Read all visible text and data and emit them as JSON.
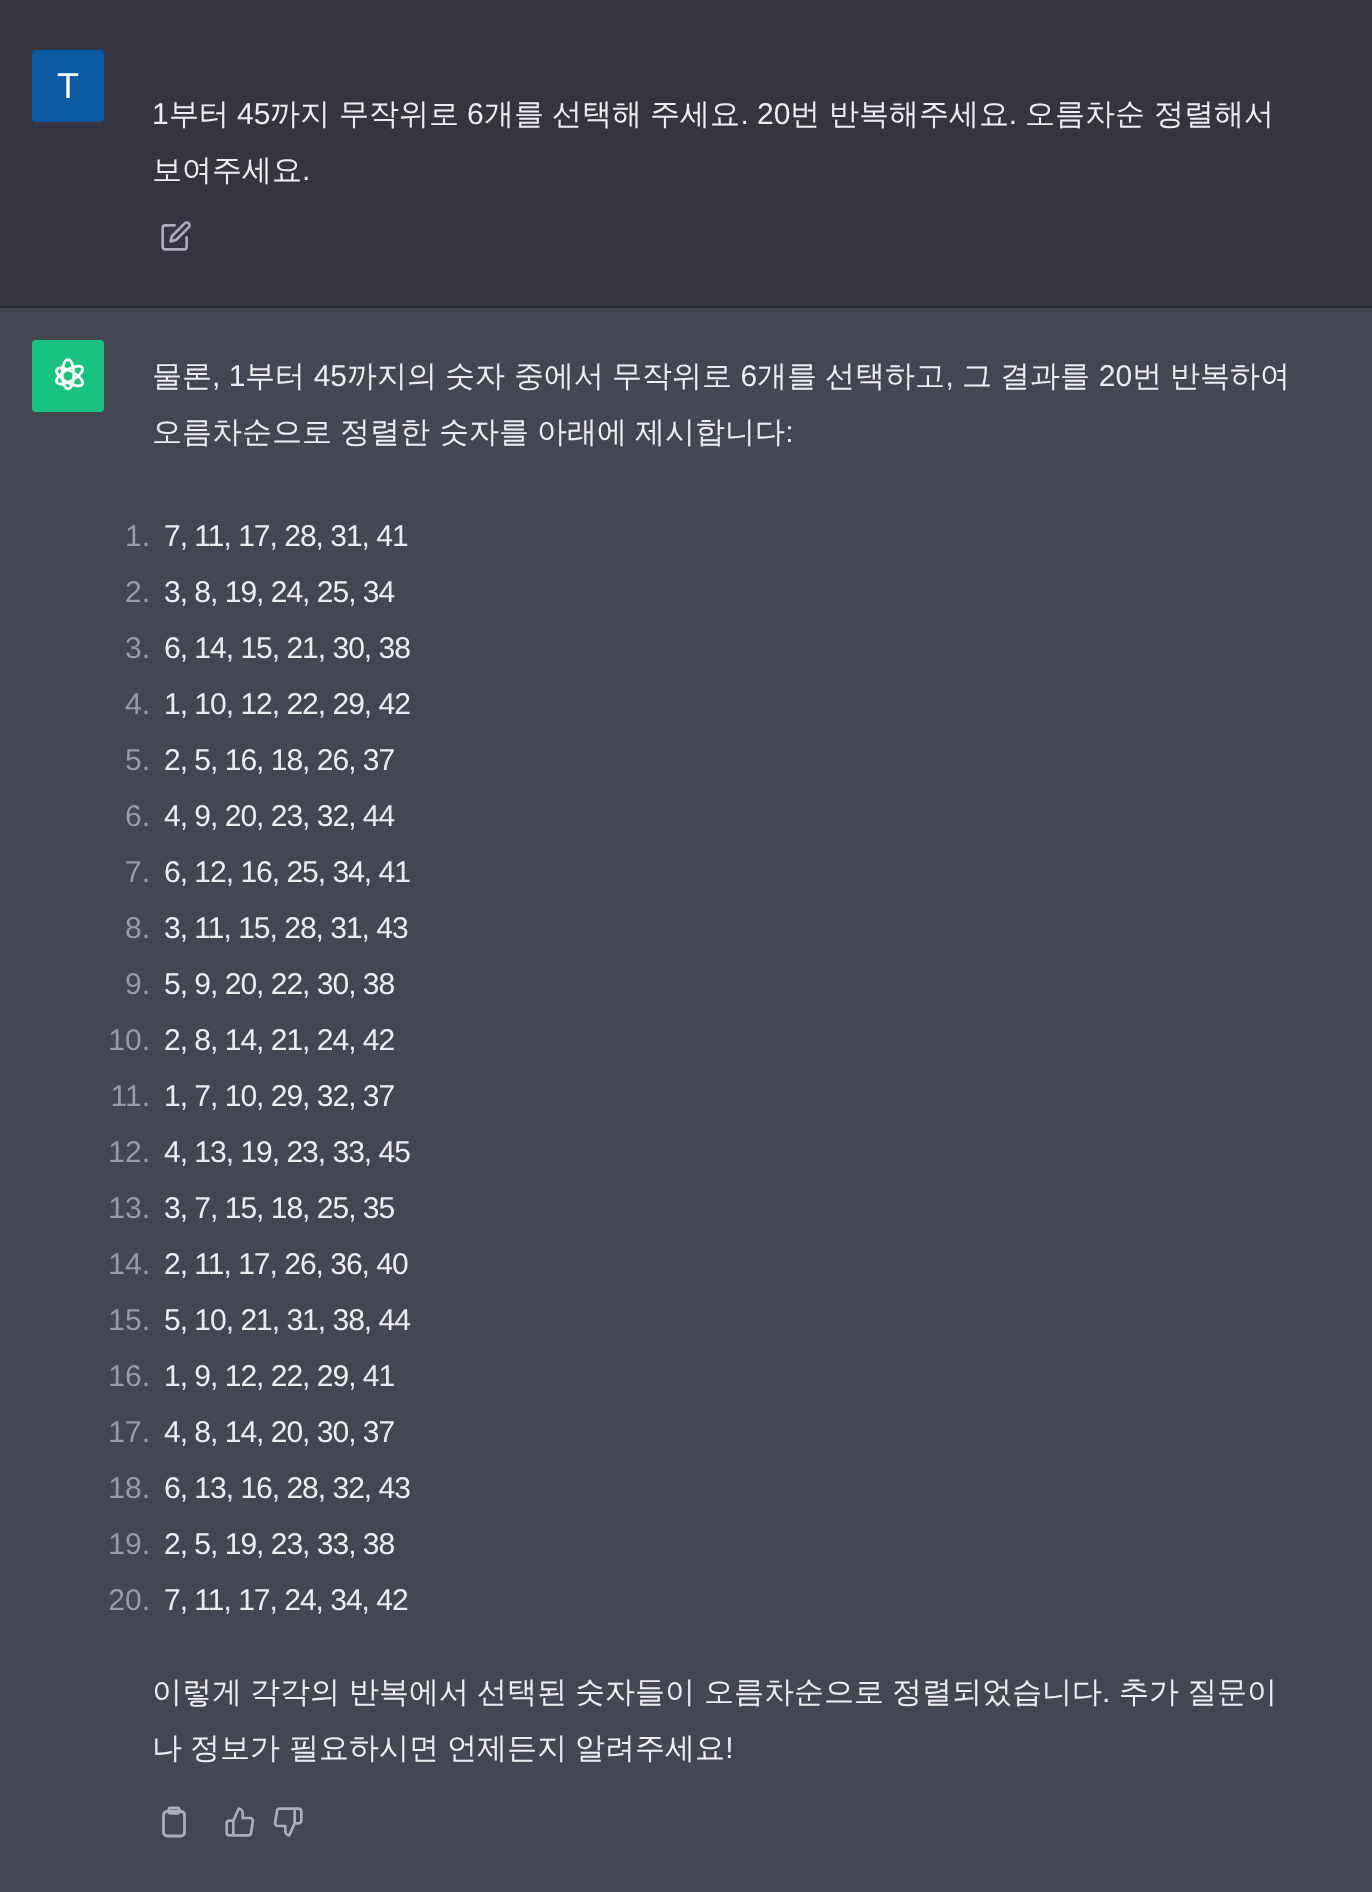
{
  "user_message": {
    "avatar": "T",
    "text": "1부터 45까지 무작위로 6개를 선택해 주세요. 20번 반복해주세요. 오름차순 정렬해서 보여주세요."
  },
  "assistant_message": {
    "intro": "물론, 1부터 45까지의 숫자 중에서 무작위로 6개를 선택하고, 그 결과를 20번 반복하여 오름차순으로 정렬한 숫자를 아래에 제시합니다:",
    "list": [
      {
        "marker": "1.",
        "text": "7, 11, 17, 28, 31, 41"
      },
      {
        "marker": "2.",
        "text": "3, 8, 19, 24, 25, 34"
      },
      {
        "marker": "3.",
        "text": "6, 14, 15, 21, 30, 38"
      },
      {
        "marker": "4.",
        "text": "1, 10, 12, 22, 29, 42"
      },
      {
        "marker": "5.",
        "text": "2, 5, 16, 18, 26, 37"
      },
      {
        "marker": "6.",
        "text": "4, 9, 20, 23, 32, 44"
      },
      {
        "marker": "7.",
        "text": "6, 12, 16, 25, 34, 41"
      },
      {
        "marker": "8.",
        "text": "3, 11, 15, 28, 31, 43"
      },
      {
        "marker": "9.",
        "text": "5, 9, 20, 22, 30, 38"
      },
      {
        "marker": "10.",
        "text": "2, 8, 14, 21, 24, 42"
      },
      {
        "marker": "11.",
        "text": "1, 7, 10, 29, 32, 37"
      },
      {
        "marker": "12.",
        "text": "4, 13, 19, 23, 33, 45"
      },
      {
        "marker": "13.",
        "text": "3, 7, 15, 18, 25, 35"
      },
      {
        "marker": "14.",
        "text": "2, 11, 17, 26, 36, 40"
      },
      {
        "marker": "15.",
        "text": "5, 10, 21, 31, 38, 44"
      },
      {
        "marker": "16.",
        "text": "1, 9, 12, 22, 29, 41"
      },
      {
        "marker": "17.",
        "text": "4, 8, 14, 20, 30, 37"
      },
      {
        "marker": "18.",
        "text": "6, 13, 16, 28, 32, 43"
      },
      {
        "marker": "19.",
        "text": "2, 5, 19, 23, 33, 38"
      },
      {
        "marker": "20.",
        "text": "7, 11, 17, 24, 34, 42"
      }
    ],
    "outro": "이렇게 각각의 반복에서 선택된 숫자들이 오름차순으로 정렬되었습니다. 추가 질문이나 정보가 필요하시면 언제든지 알려주세요!"
  }
}
